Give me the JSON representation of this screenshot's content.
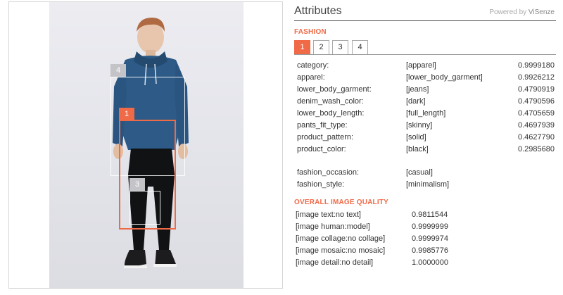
{
  "boxes": {
    "b4": "4",
    "b1": "1",
    "b3": "3"
  },
  "panel": {
    "title": "Attributes",
    "powered_by_prefix": "Powered by ",
    "powered_by_brand": "ViSenze"
  },
  "fashion": {
    "section_label": "FASHION",
    "tabs": [
      "1",
      "2",
      "3",
      "4"
    ],
    "active_tab": "1",
    "attributes": [
      {
        "key": "category:",
        "value": "[apparel]",
        "score": "0.9999180"
      },
      {
        "key": "apparel:",
        "value": "[lower_body_garment]",
        "score": "0.9926212"
      },
      {
        "key": "lower_body_garment:",
        "value": "[jeans]",
        "score": "0.4790919"
      },
      {
        "key": "denim_wash_color:",
        "value": "[dark]",
        "score": "0.4790596"
      },
      {
        "key": "lower_body_length:",
        "value": "[full_length]",
        "score": "0.4705659"
      },
      {
        "key": "pants_fit_type:",
        "value": "[skinny]",
        "score": "0.4697939"
      },
      {
        "key": "product_pattern:",
        "value": "[solid]",
        "score": "0.4627790"
      },
      {
        "key": "product_color:",
        "value": "[black]",
        "score": "0.2985680"
      }
    ],
    "extra": [
      {
        "key": "fashion_occasion:",
        "value": "[casual]"
      },
      {
        "key": "fashion_style:",
        "value": "[minimalism]"
      }
    ]
  },
  "quality": {
    "section_label": "OVERALL IMAGE QUALITY",
    "rows": [
      {
        "key": "[image text:no text]",
        "score": "0.9811544"
      },
      {
        "key": "[image human:model]",
        "score": "0.9999999"
      },
      {
        "key": "[image collage:no collage]",
        "score": "0.9999974"
      },
      {
        "key": "[image mosaic:no mosaic]",
        "score": "0.9985776"
      },
      {
        "key": "[image detail:no detail]",
        "score": "1.0000000"
      }
    ]
  },
  "colors": {
    "accent": "#f06a47",
    "header_rule": "#555555",
    "photo_background": "#e6e7ec"
  }
}
